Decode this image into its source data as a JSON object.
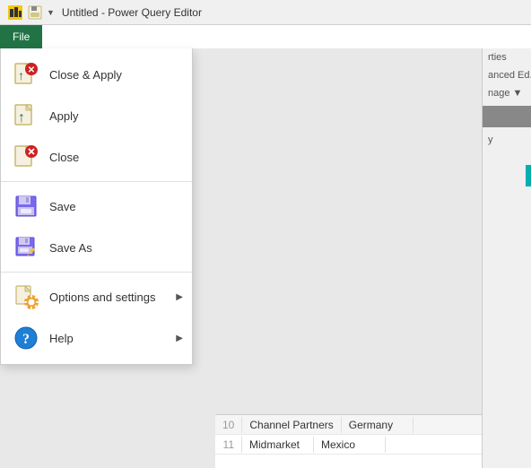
{
  "titleBar": {
    "title": "Untitled - Power Query Editor"
  },
  "ribbon": {
    "tabs": [
      {
        "label": "File",
        "active": true
      }
    ]
  },
  "rightPanel": {
    "items": [
      {
        "text": "rties"
      },
      {
        "text": "anced Ed..."
      },
      {
        "text": "nage ▼"
      },
      {
        "text": "y"
      }
    ]
  },
  "fileMenu": {
    "items": [
      {
        "id": "close-apply",
        "label": "Close & Apply",
        "icon": "close-apply-icon",
        "arrow": false
      },
      {
        "id": "apply",
        "label": "Apply",
        "icon": "apply-icon",
        "arrow": false
      },
      {
        "id": "close",
        "label": "Close",
        "icon": "close-icon",
        "arrow": false
      },
      {
        "id": "save",
        "label": "Save",
        "icon": "save-icon",
        "arrow": false
      },
      {
        "id": "save-as",
        "label": "Save As",
        "icon": "save-as-icon",
        "arrow": false
      },
      {
        "id": "options",
        "label": "Options and settings",
        "icon": "options-icon",
        "arrow": true
      },
      {
        "id": "help",
        "label": "Help",
        "icon": "help-icon",
        "arrow": true
      }
    ],
    "dividerAfter": [
      2,
      4
    ]
  },
  "bottomTable": {
    "rows": [
      {
        "rowNum": "10",
        "col1": "Channel Partners",
        "col2": "Germany"
      },
      {
        "rowNum": "11",
        "col1": "Midmarket",
        "col2": "Mexico"
      }
    ]
  },
  "colors": {
    "accent": "#217346",
    "teal": "#00b0b0",
    "menuBg": "#ffffff",
    "fileTabBg": "#217346",
    "fileTabText": "#ffffff"
  }
}
